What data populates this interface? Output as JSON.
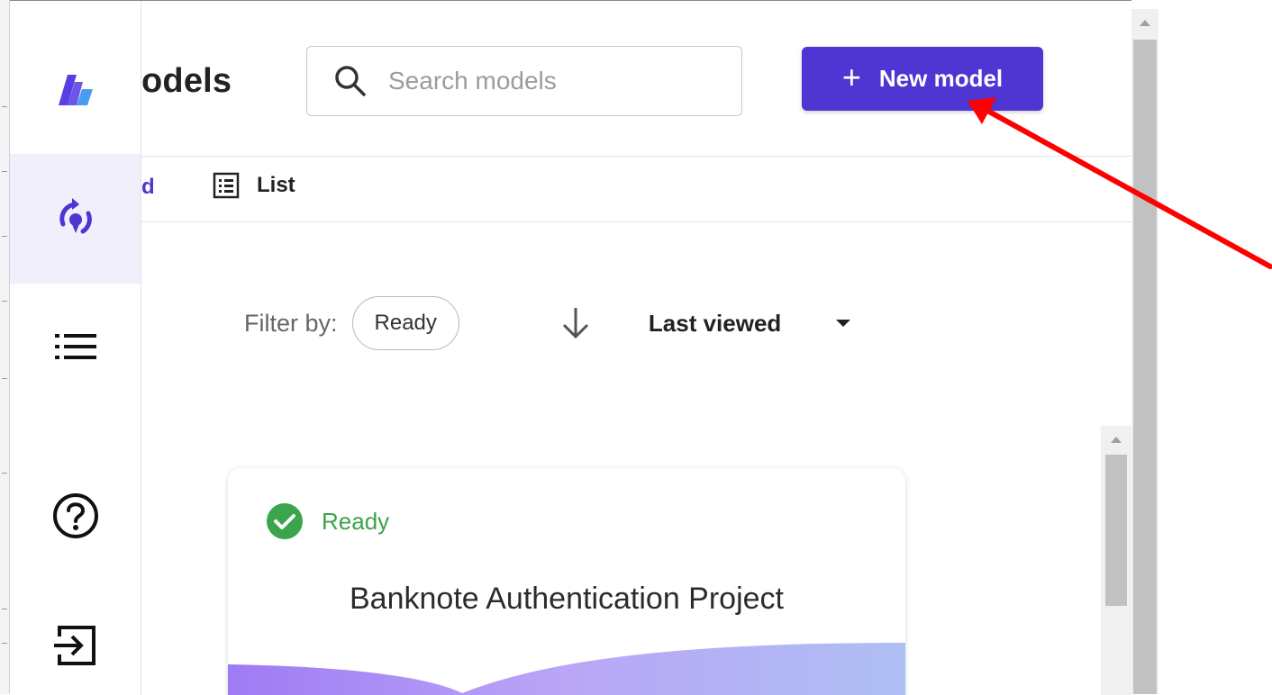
{
  "header": {
    "title": "odels",
    "search_placeholder": "Search models",
    "new_model_label": "New model"
  },
  "view_tabs": {
    "grid_label": "d",
    "list_label": "List"
  },
  "filters": {
    "filter_by_label": "Filter by:",
    "chip_ready": "Ready",
    "sort_label": "Last viewed"
  },
  "card": {
    "status": "Ready",
    "title": "Banknote Authentication Project"
  },
  "sidebar": {
    "items": [
      {
        "icon": "logo-icon"
      },
      {
        "icon": "models-icon"
      },
      {
        "icon": "list-icon"
      },
      {
        "icon": "help-icon"
      },
      {
        "icon": "sign-out-icon"
      }
    ]
  },
  "colors": {
    "accent": "#4f35d2",
    "ready_green": "#3aa54a",
    "arrow_red": "#ff0000"
  }
}
